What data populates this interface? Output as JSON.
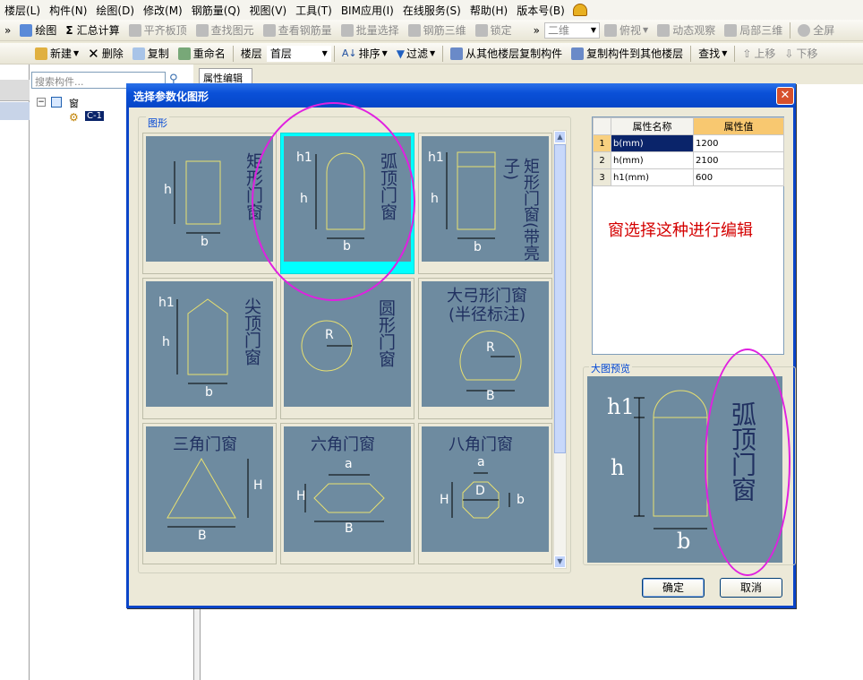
{
  "menubar": {
    "items": [
      "楼层(L)",
      "构件(N)",
      "绘图(D)",
      "修改(M)",
      "钢筋量(Q)",
      "视图(V)",
      "工具(T)",
      "BIM应用(I)",
      "在线服务(S)",
      "帮助(H)",
      "版本号(B)"
    ]
  },
  "toolbar1": {
    "chevron": "»",
    "draw": "绘图",
    "sigma": "Σ",
    "calc": "汇总计算",
    "align_slab": "平齐板顶",
    "find_element": "查找图元",
    "view_rebar": "查看钢筋量",
    "batch_select": "批量选择",
    "rebar_3d": "钢筋三维",
    "lock": "锁定",
    "chevron2": "»",
    "view_mode": "二维",
    "top_view": "俯视",
    "dynamic_view": "动态观察",
    "local_3d": "局部三维",
    "fullscreen": "全屏"
  },
  "toolbar2": {
    "new": "新建",
    "delete": "删除",
    "copy": "复制",
    "rename": "重命名",
    "floor_label": "楼层",
    "floor_value": "首层",
    "sort": "排序",
    "filter": "过滤",
    "copy_from_floor": "从其他楼层复制构件",
    "copy_to_floor": "复制构件到其他楼层",
    "find": "查找",
    "move_up": "上移",
    "move_down": "下移"
  },
  "left_panel": {
    "search_placeholder": "搜索构件...",
    "tree_root": "窗",
    "tree_child": "C-1",
    "prop_tab": "属性编辑"
  },
  "dialog": {
    "title": "选择参数化图形",
    "shapes_caption": "图形",
    "preview_caption": "大图预览",
    "ok": "确定",
    "cancel": "取消",
    "annotation": "窗选择这种进行编辑",
    "selected_index": 1
  },
  "shapes": [
    {
      "name": "矩形门窗",
      "labels": [
        "h",
        "b"
      ]
    },
    {
      "name": "弧顶门窗",
      "labels": [
        "h1",
        "h",
        "b"
      ]
    },
    {
      "name": "矩形门窗(带亮子)",
      "labels": [
        "h1",
        "h",
        "b"
      ]
    },
    {
      "name": "尖顶门窗",
      "labels": [
        "h1",
        "h",
        "b"
      ]
    },
    {
      "name": "圆形门窗",
      "labels": [
        "R"
      ]
    },
    {
      "name": "大弓形门窗(半径标注)",
      "labels": [
        "R",
        "B"
      ]
    },
    {
      "name": "三角门窗",
      "labels": [
        "H",
        "B"
      ]
    },
    {
      "name": "六角门窗",
      "labels": [
        "a",
        "H",
        "B"
      ]
    },
    {
      "name": "八角门窗",
      "labels": [
        "a",
        "D",
        "H",
        "b"
      ]
    }
  ],
  "properties": {
    "col_name": "属性名称",
    "col_value": "属性值",
    "rows": [
      {
        "no": "1",
        "name": "b(mm)",
        "value": "1200"
      },
      {
        "no": "2",
        "name": "h(mm)",
        "value": "2100"
      },
      {
        "no": "3",
        "name": "h1(mm)",
        "value": "600"
      }
    ]
  },
  "colors": {
    "tile_bg": "#6e8ba0",
    "selection": "#00ffff",
    "highlight_ellipse": "#e020e0",
    "annotation": "#d40000",
    "titlebar": "#0a50d8"
  }
}
